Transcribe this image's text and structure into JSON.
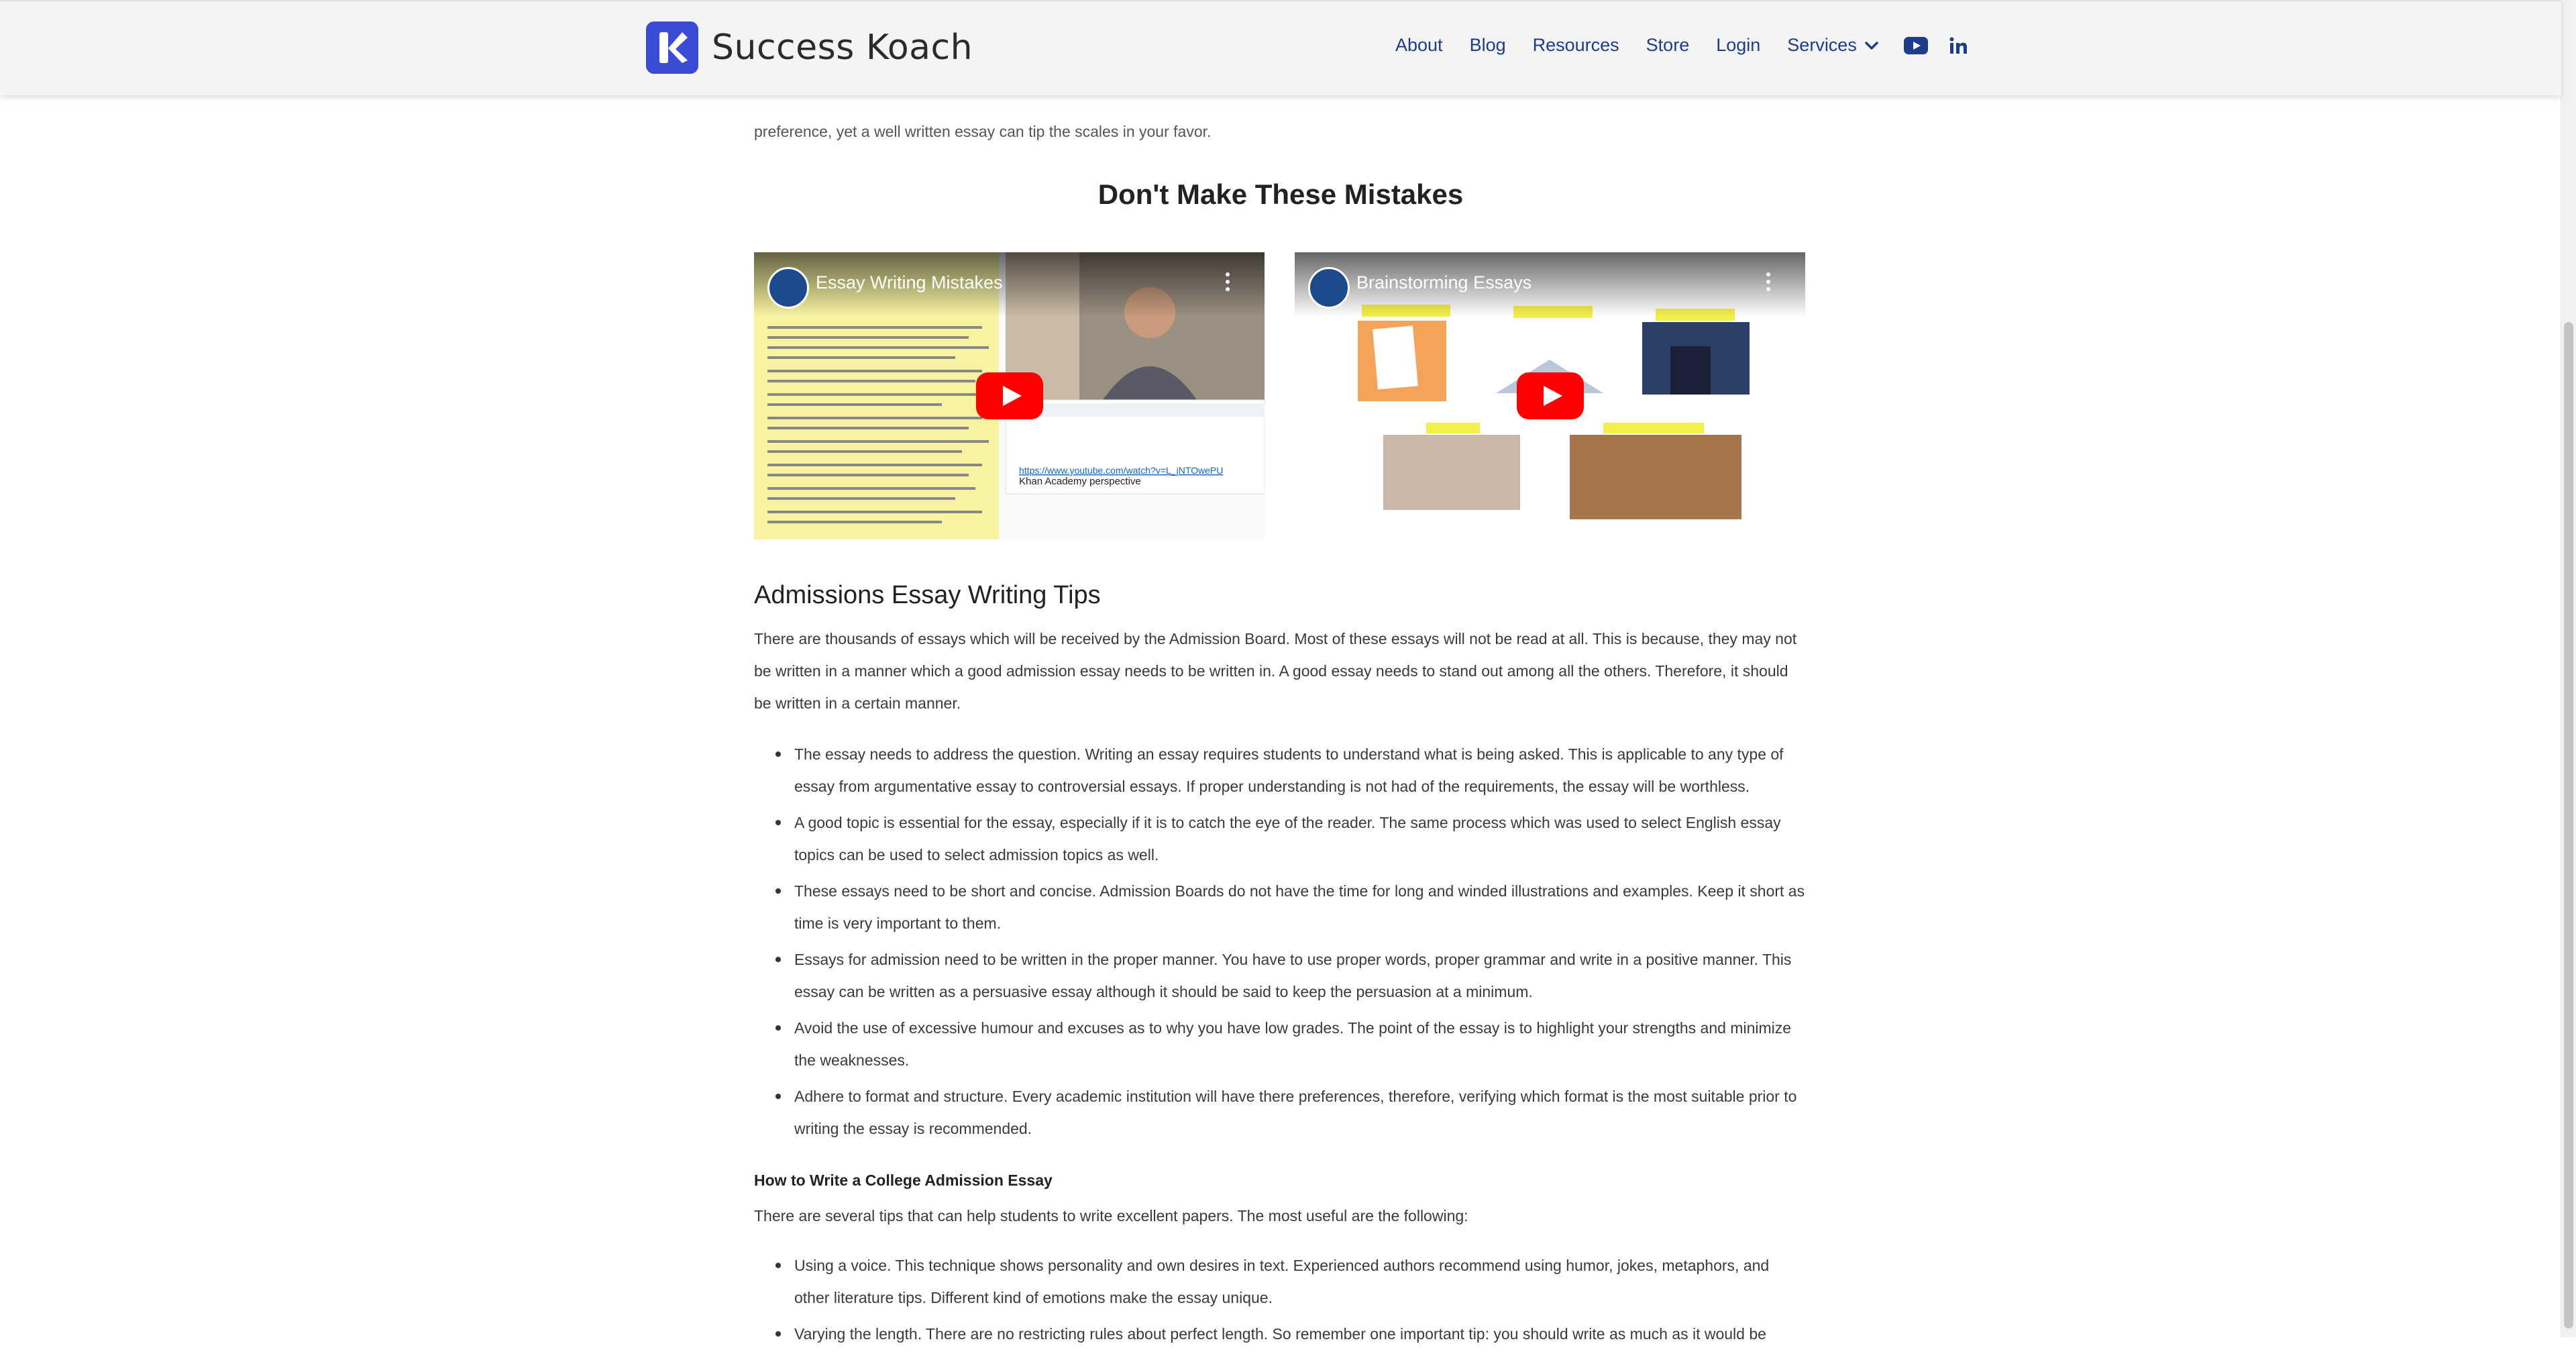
{
  "header": {
    "brand": "Success Koach",
    "nav": {
      "about": "About",
      "blog": "Blog",
      "resources": "Resources",
      "store": "Store",
      "login": "Login",
      "services": "Services"
    },
    "icons": [
      "logo-k",
      "chevron-down-icon",
      "youtube-icon",
      "linkedin-icon"
    ],
    "colors": {
      "nav": "#1f3c88",
      "brand_mark": "#3a4bd8"
    }
  },
  "intro": {
    "cut_line": "…preference, yet a well written essay can tip the scales in your favor.",
    "tail": "preference, yet a well written essay can tip the scales in your favor."
  },
  "mistakes": {
    "heading": "Don't Make These Mistakes",
    "videos": [
      {
        "title": "Essay Writing Mistakes"
      },
      {
        "title": "Brainstorming Essays"
      }
    ]
  },
  "tips": {
    "heading": "Admissions Essay Writing Tips",
    "intro": "There are thousands of essays which will be received by the Admission Board. Most of these essays will not be read at all. This is because, they may not be written in a manner which a good admission essay needs to be written in. A good essay needs to stand out among all the others. Therefore, it should be written in a certain manner.",
    "items": [
      "The essay needs to address the question. Writing an essay requires students to understand what is being asked. This is applicable to any type of essay from argumentative essay to controversial essays. If proper understanding is not had of the requirements, the essay will be worthless.",
      "A good topic is essential for the essay, especially if it is to catch the eye of the reader. The same process which was used to select English essay topics can be used to select admission topics as well.",
      "These essays need to be short and concise. Admission Boards do not have the time for long and winded illustrations and examples. Keep it short as time is very important to them.",
      "Essays for admission need to be written in the proper manner. You have to use proper words, proper grammar and write in a positive manner. This essay can be written as a persuasive essay although it should be said to keep the persuasion at a minimum.",
      "Avoid the use of excessive humour and excuses as to why you have low grades. The point of the essay is to highlight your strengths and minimize the weaknesses.",
      "Adhere to format and structure. Every academic institution will have there preferences, therefore, verifying which format is the most suitable prior to writing the essay is recommended."
    ]
  },
  "how": {
    "heading": "How to Write a College Admission Essay",
    "intro": "There are several tips that can help students to write excellent papers. The most useful are the following:",
    "items": [
      "Using a voice. This technique shows personality and own desires in text. Experienced authors recommend using humor, jokes, metaphors, and other literature tips. Different kind of emotions make the essay unique.",
      "Varying the length. There are no restricting rules about perfect length. So remember one important tip: you should write as much as it would be"
    ]
  }
}
